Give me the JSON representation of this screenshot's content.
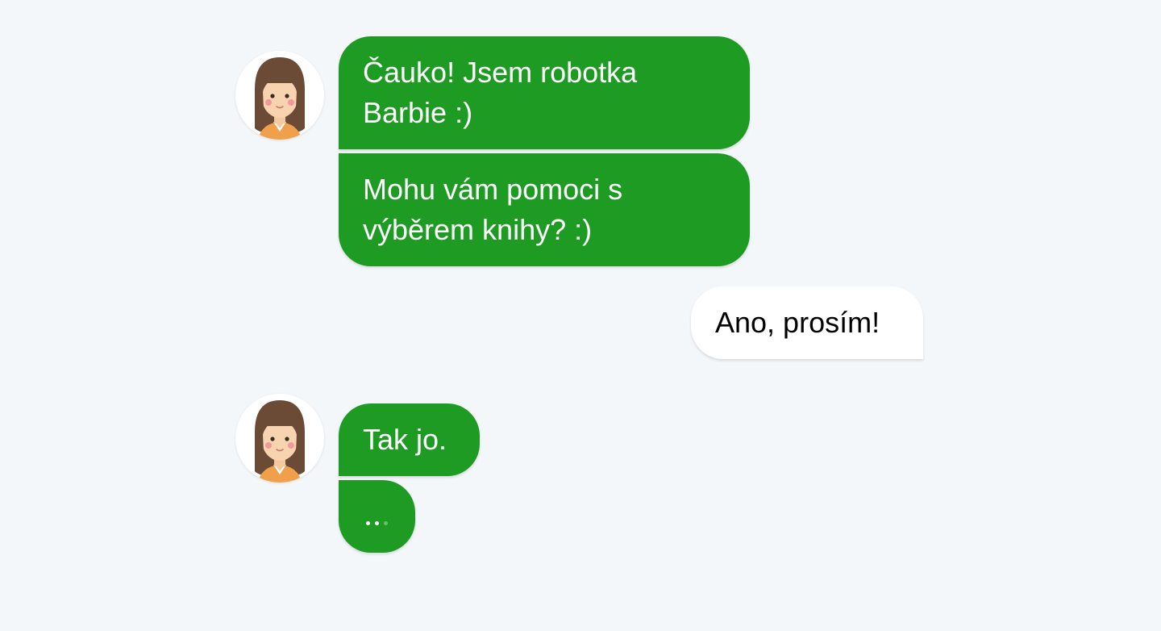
{
  "colors": {
    "page_background": "#f4f7fa",
    "bot_bubble": "#1e9b22",
    "bot_text": "#ffffff",
    "user_bubble": "#ffffff",
    "user_text": "#000000"
  },
  "bot": {
    "avatar_icon": "girl-avatar-icon"
  },
  "messages": [
    {
      "sender": "bot",
      "text": "Čauko! Jsem robotka Barbie :)"
    },
    {
      "sender": "bot",
      "text": "Mohu vám pomoci s výběrem knihy? :)"
    },
    {
      "sender": "user",
      "text": "Ano, prosím!"
    },
    {
      "sender": "bot",
      "text": "Tak jo."
    },
    {
      "sender": "bot",
      "typing": true
    }
  ]
}
